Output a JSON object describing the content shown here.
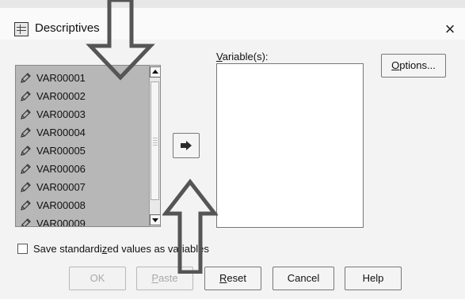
{
  "dialog": {
    "title": "Descriptives",
    "close_glyph": "×",
    "title_icon": "descriptives-icon"
  },
  "source": {
    "items": [
      {
        "label": "VAR00001",
        "icon": "scale-variable-icon"
      },
      {
        "label": "VAR00002",
        "icon": "scale-variable-icon"
      },
      {
        "label": "VAR00003",
        "icon": "scale-variable-icon"
      },
      {
        "label": "VAR00004",
        "icon": "scale-variable-icon"
      },
      {
        "label": "VAR00005",
        "icon": "scale-variable-icon"
      },
      {
        "label": "VAR00006",
        "icon": "scale-variable-icon"
      },
      {
        "label": "VAR00007",
        "icon": "scale-variable-icon"
      },
      {
        "label": "VAR00008",
        "icon": "scale-variable-icon"
      },
      {
        "label": "VAR00009",
        "icon": "scale-variable-icon"
      }
    ]
  },
  "target": {
    "label_underlined": "V",
    "label_rest": "ariable(s):",
    "items": []
  },
  "options_button": {
    "underlined": "O",
    "rest": "ptions..."
  },
  "checkbox": {
    "label_before": "Save standardi",
    "label_underlined": "z",
    "label_after": "ed values as variables",
    "checked": false
  },
  "buttons": {
    "ok": {
      "label": "OK",
      "enabled": false
    },
    "paste": {
      "underlined": "P",
      "rest": "aste",
      "enabled": false
    },
    "reset": {
      "underlined": "R",
      "rest": "eset",
      "enabled": true
    },
    "cancel": {
      "label": "Cancel",
      "enabled": true
    },
    "help": {
      "label": "Help",
      "enabled": true
    }
  },
  "colors": {
    "source_bg": "#b7b7b7",
    "annotation_arrow": "#555555"
  }
}
